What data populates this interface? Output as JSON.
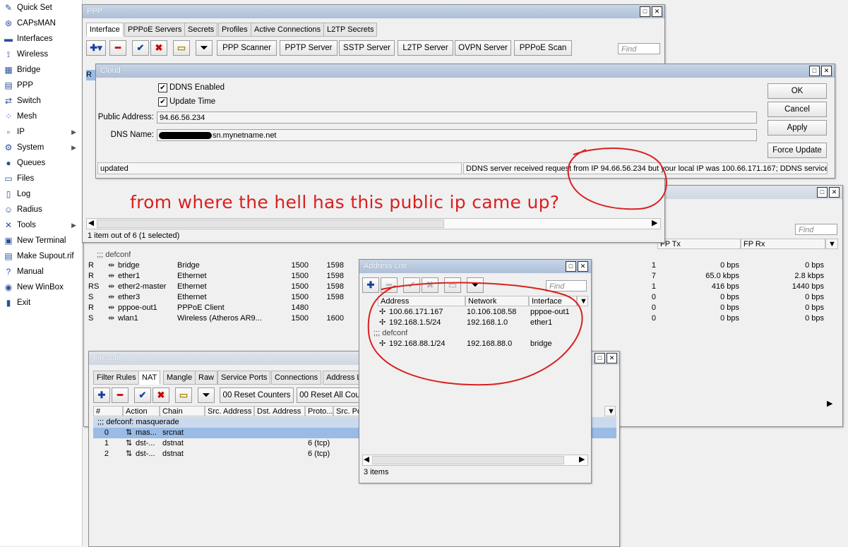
{
  "sidebar": {
    "items": [
      {
        "label": "Quick Set",
        "icon": "quick-set-icon",
        "glyph": "✎",
        "arrow": ""
      },
      {
        "label": "CAPsMAN",
        "icon": "capsman-icon",
        "glyph": "⊛",
        "arrow": ""
      },
      {
        "label": "Interfaces",
        "icon": "interfaces-icon",
        "glyph": "▬",
        "arrow": ""
      },
      {
        "label": "Wireless",
        "icon": "wireless-icon",
        "glyph": "⟟",
        "arrow": ""
      },
      {
        "label": "Bridge",
        "icon": "bridge-icon",
        "glyph": "▦",
        "arrow": ""
      },
      {
        "label": "PPP",
        "icon": "ppp-icon",
        "glyph": "▤",
        "arrow": ""
      },
      {
        "label": "Switch",
        "icon": "switch-icon",
        "glyph": "⇄",
        "arrow": ""
      },
      {
        "label": "Mesh",
        "icon": "mesh-icon",
        "glyph": "⁘",
        "arrow": ""
      },
      {
        "label": "IP",
        "icon": "ip-icon",
        "glyph": "▫",
        "arrow": "▶"
      },
      {
        "label": "System",
        "icon": "gear-icon",
        "glyph": "⚙",
        "arrow": "▶"
      },
      {
        "label": "Queues",
        "icon": "queues-icon",
        "glyph": "●",
        "arrow": ""
      },
      {
        "label": "Files",
        "icon": "folder-icon",
        "glyph": "▭",
        "arrow": ""
      },
      {
        "label": "Log",
        "icon": "log-icon",
        "glyph": "▯",
        "arrow": ""
      },
      {
        "label": "Radius",
        "icon": "users-icon",
        "glyph": "☺",
        "arrow": ""
      },
      {
        "label": "Tools",
        "icon": "tools-icon",
        "glyph": "✕",
        "arrow": "▶"
      },
      {
        "label": "New Terminal",
        "icon": "terminal-icon",
        "glyph": "▣",
        "arrow": ""
      },
      {
        "label": "Make Supout.rif",
        "icon": "document-icon",
        "glyph": "▤",
        "arrow": ""
      },
      {
        "label": "Manual",
        "icon": "help-icon",
        "glyph": "?",
        "arrow": ""
      },
      {
        "label": "New WinBox",
        "icon": "globe-icon",
        "glyph": "◉",
        "arrow": ""
      },
      {
        "label": "Exit",
        "icon": "exit-icon",
        "glyph": "▮",
        "arrow": ""
      }
    ]
  },
  "ppp": {
    "title": "PPP",
    "tabs": [
      "Interface",
      "PPPoE Servers",
      "Secrets",
      "Profiles",
      "Active Connections",
      "L2TP Secrets"
    ],
    "buttons": [
      "PPP Scanner",
      "PPTP Server",
      "SSTP Server",
      "L2TP Server",
      "OVPN Server",
      "PPPoE Scan"
    ],
    "find_placeholder": "Find",
    "row_flag": "R",
    "status": "1 item out of 6 (1 selected)"
  },
  "cloud": {
    "title": "Cloud",
    "ddns_enabled": "DDNS Enabled",
    "update_time": "Update Time",
    "public_address_label": "Public Address:",
    "public_address": "94.66.56.234",
    "dns_name_label": "DNS Name:",
    "dns_name": "sn.mynetname.net",
    "buttons": {
      "ok": "OK",
      "cancel": "Cancel",
      "apply": "Apply",
      "force_update": "Force Update"
    },
    "status_left": "updated",
    "status_right": "DDNS server received request from IP 94.66.56.234 but your local IP was 100.66.171.167; DDNS service ..."
  },
  "annotation": "from where the hell has this public ip came up?",
  "interfaces": {
    "find_placeholder": "Find",
    "headers": {
      "fp_tx": "FP Tx",
      "fp_rx": "FP Rx"
    },
    "group": ";;; defconf",
    "rows": [
      {
        "flag": "R",
        "name": "bridge",
        "type": "Bridge",
        "mtu": "1500",
        "l2mtu": "1598",
        "col": "1",
        "tx": "0 bps",
        "rx": "0 bps"
      },
      {
        "flag": "R",
        "name": "ether1",
        "type": "Ethernet",
        "mtu": "1500",
        "l2mtu": "1598",
        "col": "7",
        "tx": "65.0 kbps",
        "rx": "2.8 kbps"
      },
      {
        "flag": "RS",
        "name": "ether2-master",
        "type": "Ethernet",
        "mtu": "1500",
        "l2mtu": "1598",
        "col": "1",
        "tx": "416 bps",
        "rx": "1440 bps"
      },
      {
        "flag": "S",
        "name": "ether3",
        "type": "Ethernet",
        "mtu": "1500",
        "l2mtu": "1598",
        "col": "0",
        "tx": "0 bps",
        "rx": "0 bps"
      },
      {
        "flag": "R",
        "name": "pppoe-out1",
        "type": "PPPoE Client",
        "mtu": "1480",
        "l2mtu": "",
        "col": "0",
        "tx": "0 bps",
        "rx": "0 bps"
      },
      {
        "flag": "S",
        "name": "wlan1",
        "type": "Wireless (Atheros AR9...",
        "mtu": "1500",
        "l2mtu": "1600",
        "col": "0",
        "tx": "0 bps",
        "rx": "0 bps"
      }
    ]
  },
  "address_list": {
    "title": "Address List",
    "find_placeholder": "Find",
    "headers": [
      "Address",
      "Network",
      "Interface"
    ],
    "rows": [
      {
        "address": "100.66.171.167",
        "network": "10.106.108.58",
        "interface": "pppoe-out1"
      },
      {
        "address": "192.168.1.5/24",
        "network": "192.168.1.0",
        "interface": "ether1"
      }
    ],
    "group": ";;; defconf",
    "rows2": [
      {
        "address": "192.168.88.1/24",
        "network": "192.168.88.0",
        "interface": "bridge"
      }
    ],
    "status": "3 items"
  },
  "firewall": {
    "title": "Firewall",
    "tabs": [
      "Filter Rules",
      "NAT",
      "Mangle",
      "Raw",
      "Service Ports",
      "Connections",
      "Address L"
    ],
    "buttons": {
      "reset_counters": "00 Reset Counters",
      "reset_all": "00 Reset All Cou"
    },
    "headers": [
      "#",
      "Action",
      "Chain",
      "Src. Address",
      "Dst. Address",
      "Proto...",
      "Src. Po"
    ],
    "group": ";;; defconf: masquerade",
    "rows": [
      {
        "num": "0",
        "action": "mas...",
        "chain": "srcnat",
        "proto": ""
      },
      {
        "num": "1",
        "action": "dst-...",
        "chain": "dstnat",
        "proto": "6 (tcp)"
      },
      {
        "num": "2",
        "action": "dst-...",
        "chain": "dstnat",
        "proto": "6 (tcp)"
      }
    ]
  },
  "colors": {
    "annotation": "#d92020",
    "selected_row": "#99bbe6",
    "titlebar": "#b8c8dc"
  }
}
